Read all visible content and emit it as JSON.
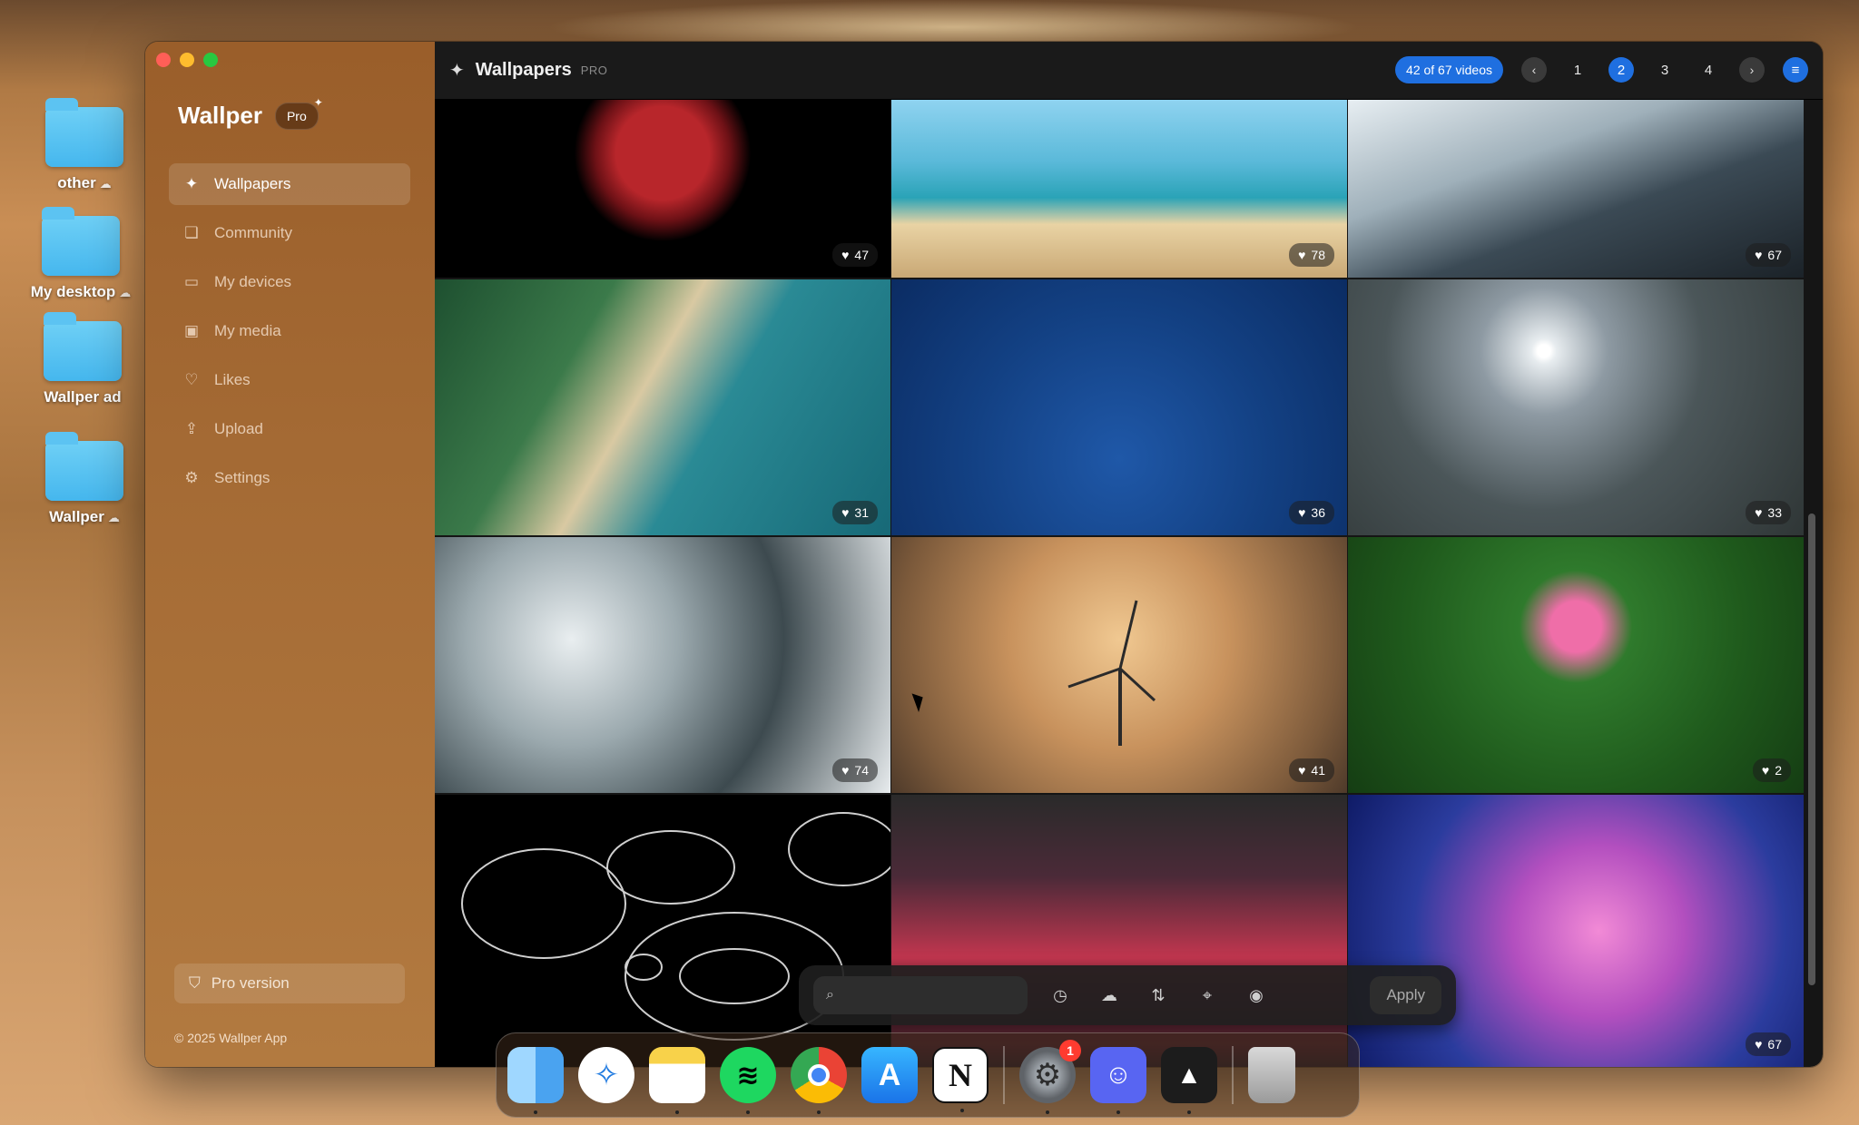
{
  "desktop": {
    "items": [
      {
        "label": "other"
      },
      {
        "label": "My desktop"
      },
      {
        "label": "Wallper ad"
      },
      {
        "label": "Wallper"
      }
    ]
  },
  "sidebar": {
    "app_name": "Wallper",
    "pro_badge": "Pro",
    "items": [
      {
        "label": "Wallpapers",
        "icon": "sparkle-icon"
      },
      {
        "label": "Community",
        "icon": "community-icon"
      },
      {
        "label": "My devices",
        "icon": "laptop-icon"
      },
      {
        "label": "My media",
        "icon": "photos-icon"
      },
      {
        "label": "Likes",
        "icon": "heart-icon"
      },
      {
        "label": "Upload",
        "icon": "upload-icon"
      },
      {
        "label": "Settings",
        "icon": "gear-icon"
      }
    ],
    "pro_version_label": "Pro version",
    "copyright": "© 2025 Wallper App"
  },
  "header": {
    "title": "Wallpapers",
    "badge": "PRO",
    "count_label": "42 of 67 videos",
    "pages": [
      "1",
      "2",
      "3",
      "4"
    ],
    "active_page": "2"
  },
  "wallpapers": [
    {
      "likes": "47"
    },
    {
      "likes": "78"
    },
    {
      "likes": "67"
    },
    {
      "likes": "31"
    },
    {
      "likes": "36"
    },
    {
      "likes": "33"
    },
    {
      "likes": "74"
    },
    {
      "likes": "41"
    },
    {
      "likes": "2"
    },
    {
      "likes": ""
    },
    {
      "likes": ""
    },
    {
      "likes": "67"
    }
  ],
  "searchbar": {
    "placeholder": "",
    "apply_label": "Apply"
  },
  "dock": {
    "settings_badge": "1"
  }
}
